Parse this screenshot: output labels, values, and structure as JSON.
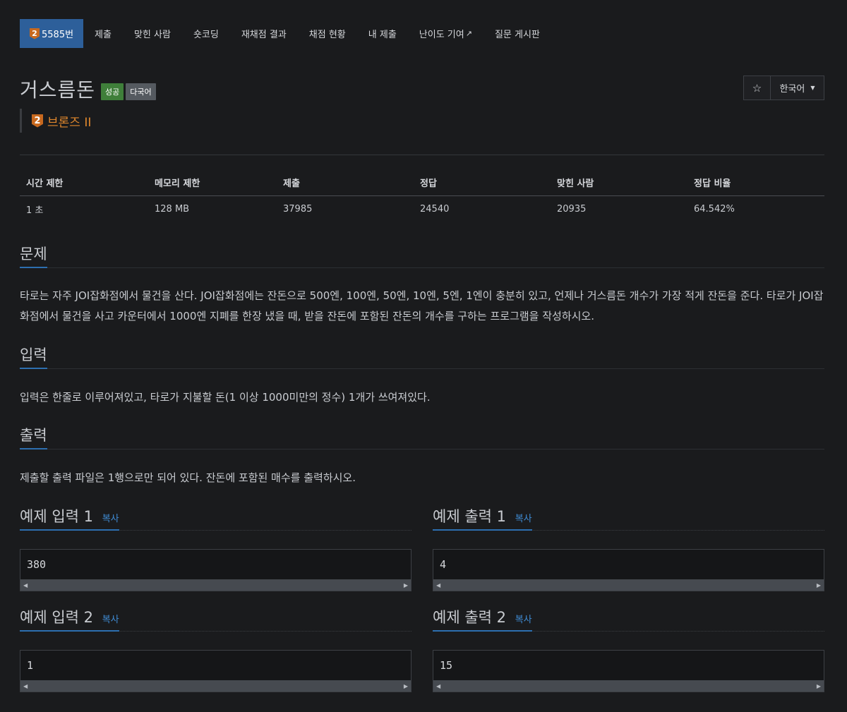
{
  "nav": {
    "items": [
      {
        "label": "5585번",
        "active": true
      },
      {
        "label": "제출"
      },
      {
        "label": "맞힌 사람"
      },
      {
        "label": "숏코딩"
      },
      {
        "label": "재채점 결과"
      },
      {
        "label": "채점 현황"
      },
      {
        "label": "내 제출"
      },
      {
        "label": "난이도 기여"
      },
      {
        "label": "질문 게시판"
      }
    ],
    "tier_number": "2"
  },
  "problem": {
    "title": "거스름돈",
    "labels": [
      "성공",
      "다국어"
    ],
    "tier": "브론즈 II",
    "tier_number": "2"
  },
  "tools": {
    "star": "☆",
    "language": "한국어"
  },
  "stats": {
    "headers": [
      "시간 제한",
      "메모리 제한",
      "제출",
      "정답",
      "맞힌 사람",
      "정답 비율"
    ],
    "values": [
      "1 초",
      "128 MB",
      "37985",
      "24540",
      "20935",
      "64.542%"
    ]
  },
  "sections": {
    "problem_head": "문제",
    "problem_text": "타로는 자주 JOI잡화점에서 물건을 산다. JOI잡화점에는 잔돈으로 500엔, 100엔, 50엔, 10엔, 5엔, 1엔이 충분히 있고, 언제나 거스름돈 개수가 가장 적게 잔돈을 준다. 타로가 JOI잡화점에서 물건을 사고 카운터에서 1000엔 지폐를 한장 냈을 때, 받을 잔돈에 포함된 잔돈의 개수를 구하는 프로그램을 작성하시오.",
    "input_head": "입력",
    "input_text": "입력은 한줄로 이루어져있고, 타로가 지불할 돈(1 이상 1000미만의 정수) 1개가 쓰여져있다.",
    "output_head": "출력",
    "output_text": "제출할 출력 파일은 1행으로만 되어 있다. 잔돈에 포함된 매수를 출력하시오."
  },
  "samples": {
    "copy_label": "복사",
    "in1_title": "예제 입력 1",
    "in1_value": "380",
    "out1_title": "예제 출력 1",
    "out1_value": "4",
    "in2_title": "예제 입력 2",
    "in2_value": "1",
    "out2_title": "예제 출력 2",
    "out2_value": "15"
  },
  "colors": {
    "active_nav": "#2d5f9a",
    "tier_bronze": "#e0872d",
    "accent": "#2d6fb0",
    "success": "#3f7f3a"
  }
}
